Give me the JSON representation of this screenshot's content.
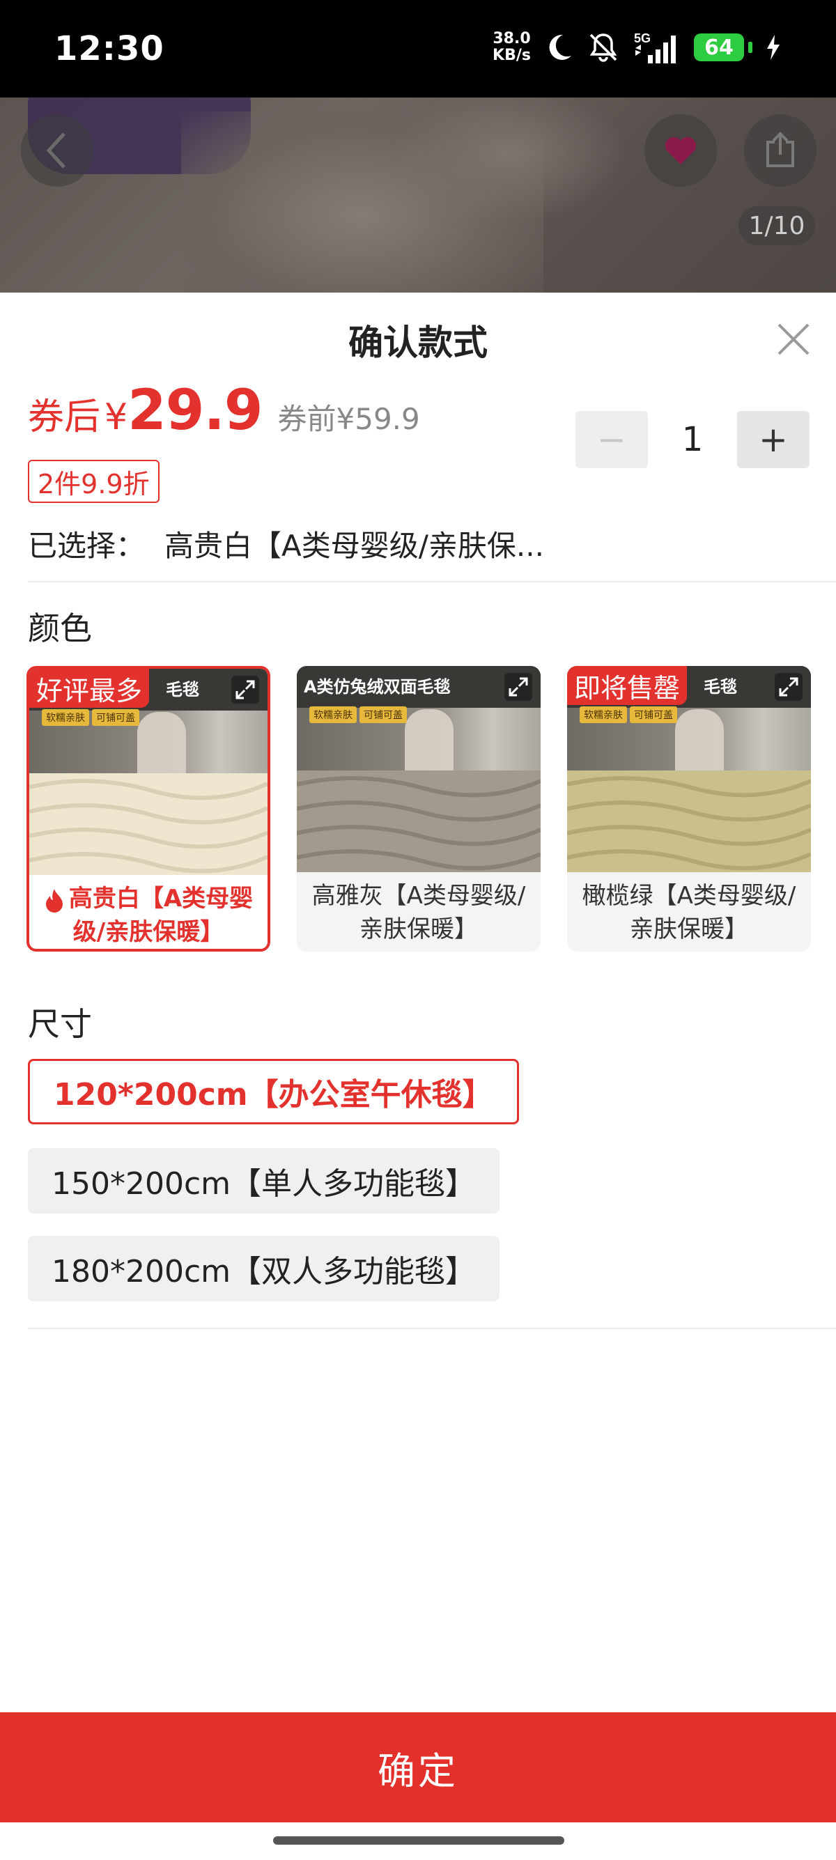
{
  "status_bar": {
    "time": "12:30",
    "net_speed_value": "38.0",
    "net_speed_unit": "KB/s",
    "network": "5G",
    "battery": "64",
    "icons": [
      "moon-icon",
      "bell-off-icon",
      "signal-icon",
      "battery-icon",
      "charging-icon"
    ]
  },
  "gallery": {
    "page_indicator": "1/10"
  },
  "sheet": {
    "title": "确认款式",
    "price": {
      "prefix": "券后",
      "currency": "¥",
      "value": "29.9",
      "before": "券前¥59.9"
    },
    "quantity": {
      "minus": "−",
      "value": "1",
      "plus": "+"
    },
    "promo_tag": "2件9.9折",
    "selected": {
      "label": "已选择：",
      "value": "高贵白【A类母婴级/亲肤保..."
    },
    "color_section": {
      "label": "颜色",
      "options": [
        {
          "badge": "好评最多",
          "image_caption": "毛毯",
          "subtags": [
            "软糯亲肤",
            "可铺可盖"
          ],
          "label": "高贵白【A类母婴级/亲肤保暖】",
          "selected": true
        },
        {
          "badge": "",
          "image_caption": "A类仿兔绒双面毛毯",
          "subtags": [
            "软糯亲肤",
            "可铺可盖"
          ],
          "label": "高雅灰【A类母婴级/亲肤保暖】",
          "selected": false
        },
        {
          "badge": "即将售罄",
          "image_caption": "毛毯",
          "subtags": [
            "软糯亲肤",
            "可铺可盖"
          ],
          "label": "橄榄绿【A类母婴级/亲肤保暖】",
          "selected": false
        }
      ]
    },
    "size_section": {
      "label": "尺寸",
      "options": [
        {
          "label": "120*200cm【办公室午休毯】",
          "selected": true
        },
        {
          "label": "150*200cm【单人多功能毯】",
          "selected": false
        },
        {
          "label": "180*200cm【双人多功能毯】",
          "selected": false
        }
      ]
    },
    "confirm_button": "确定"
  },
  "colors": {
    "accent": "#e3322e",
    "confirm_bg": "#e3302b",
    "card_bg": "#f4f4f4"
  }
}
